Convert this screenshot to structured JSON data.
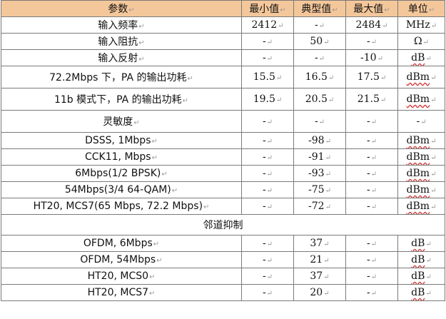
{
  "header": {
    "param": "参数",
    "min": "最小值",
    "typ": "典型值",
    "max": "最大值",
    "unit": "单位"
  },
  "rows": [
    {
      "kind": "row",
      "param": "输入频率",
      "min": "2412",
      "typ": "-",
      "max": "2484",
      "unit": "MHz",
      "tall": false
    },
    {
      "kind": "row",
      "param": "输入阻抗",
      "min": "-",
      "typ": "50",
      "max": "-",
      "unit": "Ω",
      "tall": false
    },
    {
      "kind": "row",
      "param": "输入反射",
      "min": "-",
      "typ": "-",
      "max": "-10",
      "unit": "dB",
      "tall": false
    },
    {
      "kind": "row",
      "param": "72.2Mbps 下，PA 的输出功耗",
      "min": "15.5",
      "typ": "16.5",
      "max": "17.5",
      "unit": "dBm",
      "tall": true
    },
    {
      "kind": "row",
      "param": "11b 模式下，PA 的输出功耗",
      "min": "19.5",
      "typ": "20.5",
      "max": "21.5",
      "unit": "dBm",
      "tall": true
    },
    {
      "kind": "row",
      "param": "灵敏度",
      "min": "-",
      "typ": "-",
      "max": "-",
      "unit": "-",
      "tall": true
    },
    {
      "kind": "row",
      "param": "DSSS, 1Mbps",
      "min": "-",
      "typ": "-98",
      "max": "-",
      "unit": "dBm",
      "tall": false
    },
    {
      "kind": "row",
      "param": "CCK11, Mbps",
      "min": "-",
      "typ": "-91",
      "max": "-",
      "unit": "dBm",
      "tall": false
    },
    {
      "kind": "row",
      "param": "6Mbps(1/2 BPSK)",
      "min": "-",
      "typ": "-93",
      "max": "-",
      "unit": "dBm",
      "tall": false
    },
    {
      "kind": "row",
      "param": "54Mbps(3/4 64-QAM)",
      "min": "-",
      "typ": "-75",
      "max": "-",
      "unit": "dBm",
      "tall": false
    },
    {
      "kind": "row",
      "param": "HT20, MCS7(65 Mbps, 72.2 Mbps)",
      "min": "-",
      "typ": "-72",
      "max": "-",
      "unit": "dBm",
      "tall": false
    },
    {
      "kind": "section",
      "label": "邻道抑制"
    },
    {
      "kind": "row",
      "param": "OFDM, 6Mbps",
      "min": "-",
      "typ": "37",
      "max": "-",
      "unit": "dB",
      "tall": false
    },
    {
      "kind": "row",
      "param": "OFDM, 54Mbps",
      "min": "-",
      "typ": "21",
      "max": "-",
      "unit": "dB",
      "tall": false
    },
    {
      "kind": "row",
      "param": "HT20, MCS0",
      "min": "-",
      "typ": "37",
      "max": "-",
      "unit": "dB",
      "tall": false
    },
    {
      "kind": "row",
      "param": "HT20, MCS7",
      "min": "-",
      "typ": "20",
      "max": "-",
      "unit": "dB",
      "tall": false
    }
  ],
  "colors": {
    "header_bg": "#f4c79a",
    "border": "#7a7a7a"
  }
}
